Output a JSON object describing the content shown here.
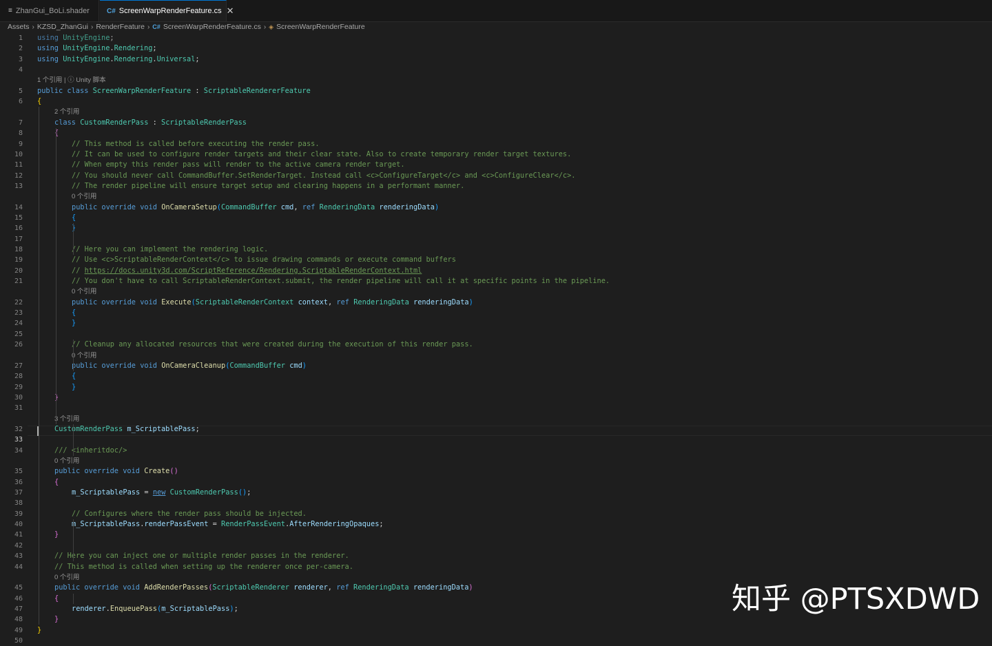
{
  "tabs": [
    {
      "icon": "≡",
      "label": "ZhanGui_BoLi.shader",
      "active": false
    },
    {
      "icon": "C#",
      "label": "ScreenWarpRenderFeature.cs",
      "active": true,
      "close": "✕"
    }
  ],
  "breadcrumb": {
    "items": [
      "Assets",
      "KZSD_ZhanGui",
      "RenderFeature",
      "ScreenWarpRenderFeature.cs",
      "ScreenWarpRenderFeature"
    ],
    "separator": "›"
  },
  "colors": {
    "background": "#1e1e1e",
    "keyword": "#569cd6",
    "type": "#4ec9b0",
    "function": "#dcdcaa",
    "variable": "#9cdcfe",
    "comment": "#6a9955",
    "bracket_level1": "#ffd700",
    "bracket_level2": "#da70d6",
    "bracket_level3": "#179fff"
  },
  "editor": {
    "current_line": 33,
    "rows": [
      {
        "n": "1",
        "parts": [
          [
            "kw",
            "using"
          ],
          [
            "",
            ""
          ],
          [
            "ty",
            ""
          ],
          [
            "",
            ""
          ]
        ],
        "text_parts": [
          [
            "kw",
            "using "
          ],
          [
            "ty",
            "UnityEngine"
          ],
          [
            "",
            ";"
          ]
        ],
        "dim": true
      },
      {
        "n": "2",
        "text_parts": [
          [
            "kw",
            "using "
          ],
          [
            "ty",
            "UnityEngine"
          ],
          [
            "",
            ".",
            ""
          ],
          [
            "ty",
            "Rendering"
          ],
          [
            "",
            ";"
          ]
        ]
      },
      {
        "n": "3",
        "text_parts": [
          [
            "kw",
            "using "
          ],
          [
            "ty",
            "UnityEngine"
          ],
          [
            "",
            "."
          ],
          [
            "ty",
            "Rendering"
          ],
          [
            "",
            "."
          ],
          [
            "ty",
            "Universal"
          ],
          [
            "",
            ";"
          ]
        ]
      },
      {
        "n": "4",
        "text_parts": []
      },
      {
        "lens": "1 个引用 | ⓘ Unity 脚本",
        "indent": 0
      },
      {
        "n": "5",
        "text_parts": [
          [
            "kw",
            "public class "
          ],
          [
            "ty",
            "ScreenWarpRenderFeature"
          ],
          [
            "",
            " : "
          ],
          [
            "ty",
            "ScriptableRendererFeature"
          ]
        ]
      },
      {
        "n": "6",
        "text_parts": [
          [
            "b1",
            "{"
          ]
        ]
      },
      {
        "lens": "2 个引用",
        "indent": 1
      },
      {
        "n": "7",
        "indent": 1,
        "text_parts": [
          [
            "kw",
            "class "
          ],
          [
            "ty",
            "CustomRenderPass"
          ],
          [
            "",
            " : "
          ],
          [
            "ty",
            "ScriptableRenderPass"
          ]
        ]
      },
      {
        "n": "8",
        "indent": 1,
        "text_parts": [
          [
            "b2",
            "{"
          ]
        ]
      },
      {
        "n": "9",
        "indent": 2,
        "text_parts": [
          [
            "cm",
            "// This method is called before executing the render pass."
          ]
        ]
      },
      {
        "n": "10",
        "indent": 2,
        "text_parts": [
          [
            "cm",
            "// It can be used to configure render targets and their clear state. Also to create temporary render target textures."
          ]
        ]
      },
      {
        "n": "11",
        "indent": 2,
        "text_parts": [
          [
            "cm",
            "// When empty this render pass will render to the active camera render target."
          ]
        ]
      },
      {
        "n": "12",
        "indent": 2,
        "text_parts": [
          [
            "cm",
            "// You should never call CommandBuffer.SetRenderTarget. Instead call <c>ConfigureTarget</c> and <c>ConfigureClear</c>."
          ]
        ]
      },
      {
        "n": "13",
        "indent": 2,
        "text_parts": [
          [
            "cm",
            "// The render pipeline will ensure target setup and clearing happens in a performant manner."
          ]
        ]
      },
      {
        "lens": "0 个引用",
        "indent": 2
      },
      {
        "n": "14",
        "indent": 2,
        "text_parts": [
          [
            "kw",
            "public override void "
          ],
          [
            "fn",
            "OnCameraSetup"
          ],
          [
            "b3",
            "("
          ],
          [
            "ty",
            "CommandBuffer "
          ],
          [
            "va",
            "cmd"
          ],
          [
            "",
            ", "
          ],
          [
            "kw",
            "ref "
          ],
          [
            "ty",
            "RenderingData "
          ],
          [
            "va",
            "renderingData"
          ],
          [
            "b3",
            ")"
          ]
        ]
      },
      {
        "n": "15",
        "indent": 2,
        "text_parts": [
          [
            "b3",
            "{"
          ]
        ]
      },
      {
        "n": "16",
        "indent": 2,
        "text_parts": [
          [
            "b3",
            "}"
          ]
        ]
      },
      {
        "n": "17",
        "text_parts": []
      },
      {
        "n": "18",
        "indent": 2,
        "text_parts": [
          [
            "cm",
            "// Here you can implement the rendering logic."
          ]
        ]
      },
      {
        "n": "19",
        "indent": 2,
        "text_parts": [
          [
            "cm",
            "// Use <c>ScriptableRenderContext</c> to issue drawing commands or execute command buffers"
          ]
        ]
      },
      {
        "n": "20",
        "indent": 2,
        "text_parts": [
          [
            "cm",
            "// "
          ],
          [
            "cm ul",
            "https://docs.unity3d.com/ScriptReference/Rendering.ScriptableRenderContext.html"
          ]
        ]
      },
      {
        "n": "21",
        "indent": 2,
        "text_parts": [
          [
            "cm",
            "// You don't have to call ScriptableRenderContext.submit, the render pipeline will call it at specific points in the pipeline."
          ]
        ]
      },
      {
        "lens": "0 个引用",
        "indent": 2
      },
      {
        "n": "22",
        "indent": 2,
        "text_parts": [
          [
            "kw",
            "public override void "
          ],
          [
            "fn",
            "Execute"
          ],
          [
            "b3",
            "("
          ],
          [
            "ty",
            "ScriptableRenderContext "
          ],
          [
            "va",
            "context"
          ],
          [
            "",
            ", "
          ],
          [
            "kw",
            "ref "
          ],
          [
            "ty",
            "RenderingData "
          ],
          [
            "va",
            "renderingData"
          ],
          [
            "b3",
            ")"
          ]
        ]
      },
      {
        "n": "23",
        "indent": 2,
        "text_parts": [
          [
            "b3",
            "{"
          ]
        ]
      },
      {
        "n": "24",
        "indent": 2,
        "text_parts": [
          [
            "b3",
            "}"
          ]
        ]
      },
      {
        "n": "25",
        "text_parts": []
      },
      {
        "n": "26",
        "indent": 2,
        "text_parts": [
          [
            "cm",
            "// Cleanup any allocated resources that were created during the execution of this render pass."
          ]
        ]
      },
      {
        "lens": "0 个引用",
        "indent": 2
      },
      {
        "n": "27",
        "indent": 2,
        "text_parts": [
          [
            "kw",
            "public override void "
          ],
          [
            "fn",
            "OnCameraCleanup"
          ],
          [
            "b3",
            "("
          ],
          [
            "ty",
            "CommandBuffer "
          ],
          [
            "va",
            "cmd"
          ],
          [
            "b3",
            ")"
          ]
        ]
      },
      {
        "n": "28",
        "indent": 2,
        "text_parts": [
          [
            "b3",
            "{"
          ]
        ]
      },
      {
        "n": "29",
        "indent": 2,
        "text_parts": [
          [
            "b3",
            "}"
          ]
        ]
      },
      {
        "n": "30",
        "indent": 1,
        "text_parts": [
          [
            "b2",
            "}"
          ]
        ]
      },
      {
        "n": "31",
        "text_parts": []
      },
      {
        "lens": "3 个引用",
        "indent": 1
      },
      {
        "n": "32",
        "indent": 1,
        "text_parts": [
          [
            "ty",
            "CustomRenderPass "
          ],
          [
            "va",
            "m_ScriptablePass"
          ],
          [
            "",
            ";"
          ]
        ]
      },
      {
        "n": "33",
        "text_parts": []
      },
      {
        "n": "34",
        "indent": 1,
        "text_parts": [
          [
            "cm",
            "/// <inheritdoc/>"
          ]
        ]
      },
      {
        "lens": "0 个引用",
        "indent": 1
      },
      {
        "n": "35",
        "indent": 1,
        "text_parts": [
          [
            "kw",
            "public override void "
          ],
          [
            "fn",
            "Create"
          ],
          [
            "b2",
            "()"
          ]
        ]
      },
      {
        "n": "36",
        "indent": 1,
        "text_parts": [
          [
            "b2",
            "{"
          ]
        ]
      },
      {
        "n": "37",
        "indent": 2,
        "text_parts": [
          [
            "va",
            "m_ScriptablePass"
          ],
          [
            "",
            " = "
          ],
          [
            "kw ul",
            "new"
          ],
          [
            "",
            " "
          ],
          [
            "ty",
            "CustomRenderPass"
          ],
          [
            "b3",
            "()"
          ],
          [
            "",
            ";"
          ]
        ]
      },
      {
        "n": "38",
        "text_parts": []
      },
      {
        "n": "39",
        "indent": 2,
        "text_parts": [
          [
            "cm",
            "// Configures where the render pass should be injected."
          ]
        ]
      },
      {
        "n": "40",
        "indent": 2,
        "text_parts": [
          [
            "va",
            "m_ScriptablePass"
          ],
          [
            "",
            "."
          ],
          [
            "va",
            "renderPassEvent"
          ],
          [
            "",
            " = "
          ],
          [
            "ty",
            "RenderPassEvent"
          ],
          [
            "",
            "."
          ],
          [
            "va",
            "AfterRenderingOpaques"
          ],
          [
            "",
            ";"
          ]
        ]
      },
      {
        "n": "41",
        "indent": 1,
        "text_parts": [
          [
            "b2",
            "}"
          ]
        ]
      },
      {
        "n": "42",
        "text_parts": []
      },
      {
        "n": "43",
        "indent": 1,
        "text_parts": [
          [
            "cm",
            "// Here you can inject one or multiple render passes in the renderer."
          ]
        ]
      },
      {
        "n": "44",
        "indent": 1,
        "text_parts": [
          [
            "cm",
            "// This method is called when setting up the renderer once per-camera."
          ]
        ]
      },
      {
        "lens": "0 个引用",
        "indent": 1
      },
      {
        "n": "45",
        "indent": 1,
        "text_parts": [
          [
            "kw",
            "public override void "
          ],
          [
            "fn",
            "AddRenderPasses"
          ],
          [
            "b2",
            "("
          ],
          [
            "ty",
            "ScriptableRenderer "
          ],
          [
            "va",
            "renderer"
          ],
          [
            "",
            ", "
          ],
          [
            "kw",
            "ref "
          ],
          [
            "ty",
            "RenderingData "
          ],
          [
            "va",
            "renderingData"
          ],
          [
            "b2",
            ")"
          ]
        ]
      },
      {
        "n": "46",
        "indent": 1,
        "text_parts": [
          [
            "b2",
            "{"
          ]
        ]
      },
      {
        "n": "47",
        "indent": 2,
        "text_parts": [
          [
            "va",
            "renderer"
          ],
          [
            "",
            "."
          ],
          [
            "fn",
            "EnqueuePass"
          ],
          [
            "b3",
            "("
          ],
          [
            "va",
            "m_ScriptablePass"
          ],
          [
            "b3",
            ")"
          ],
          [
            "",
            ";"
          ]
        ]
      },
      {
        "n": "48",
        "indent": 1,
        "text_parts": [
          [
            "b2",
            "}"
          ]
        ]
      },
      {
        "n": "49",
        "text_parts": [
          [
            "b1",
            "}"
          ]
        ]
      },
      {
        "n": "50",
        "text_parts": []
      }
    ]
  },
  "watermark": "知乎 @PTSXDWD"
}
